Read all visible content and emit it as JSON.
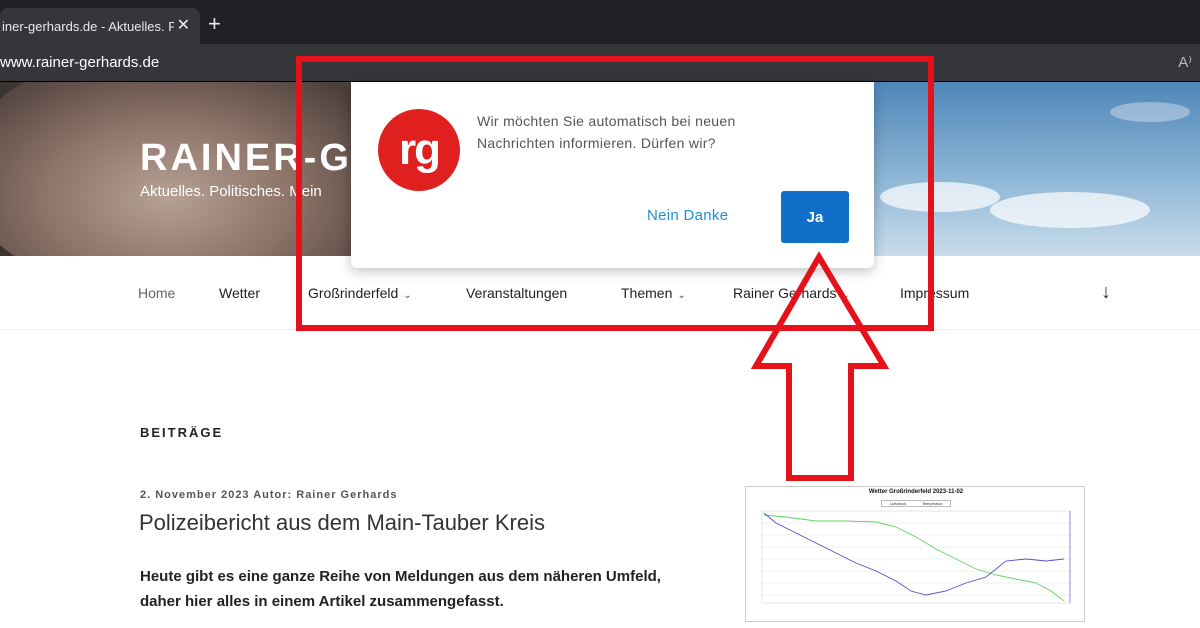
{
  "browser": {
    "tab_title": "iner-gerhards.de - Aktuelles. Po",
    "tab_close": "✕",
    "new_tab": "+",
    "url": "www.rainer-gerhards.de",
    "read_mode_icon": "A⁾"
  },
  "site": {
    "title": "RAINER-G",
    "description": "Aktuelles. Politisches. Mein"
  },
  "nav": {
    "items": [
      {
        "label": "Home"
      },
      {
        "label": "Wetter"
      },
      {
        "label": "Großrinderfeld",
        "chevron": "⌄"
      },
      {
        "label": "Veranstaltungen"
      },
      {
        "label": "Themen",
        "chevron": "⌄"
      },
      {
        "label": "Rainer Gerhards",
        "chevron": "⌄"
      },
      {
        "label": "Impressum"
      }
    ],
    "scroll_icon": "↓"
  },
  "content": {
    "section_label": "BEITRÄGE",
    "post": {
      "meta": "2. November 2023 Autor: Rainer Gerhards",
      "title": "Polizeibericht aus dem Main-Tauber Kreis",
      "excerpt": "Heute gibt es eine ganze Reihe von Meldungen aus dem näheren Umfeld, daher hier alles in einem Artikel zusammengefasst."
    }
  },
  "weather_chart": {
    "title": "Wetter Großrinderfeld 2023-11-02",
    "legend": [
      "Luftdruck",
      "Temperatur"
    ],
    "colors": {
      "green": "#5fd35f",
      "blue": "#5a4fc8"
    }
  },
  "popup": {
    "logo_text": "rg",
    "logo_color": "#e0201f",
    "message": "Wir möchten Sie automatisch bei neuen Nachrichten informieren. Dürfen wir?",
    "decline_label": "Nein Danke",
    "accept_label": "Ja",
    "accept_color": "#0f6fc9"
  },
  "annotation": {
    "color": "#e5121c"
  }
}
